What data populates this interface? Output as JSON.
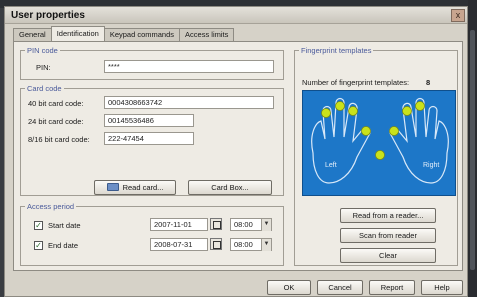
{
  "window": {
    "title": "User properties",
    "close_glyph": "x"
  },
  "tabs": [
    {
      "label": "General"
    },
    {
      "label": "Identification"
    },
    {
      "label": "Keypad commands"
    },
    {
      "label": "Access limits"
    }
  ],
  "pin": {
    "legend": "PIN code",
    "label": "PIN:",
    "value": "****"
  },
  "card": {
    "legend": "Card code",
    "rows": [
      {
        "label": "40 bit card code:",
        "value": "0004308663742"
      },
      {
        "label": "24 bit card code:",
        "value": "00145536486"
      },
      {
        "label": "8/16 bit card code:",
        "value": "222-47454"
      }
    ],
    "read_card": "Read card...",
    "card_box": "Card Box..."
  },
  "access": {
    "legend": "Access period",
    "start": {
      "label": "Start date",
      "date": "2007-11-01",
      "time": "08:00",
      "checked": true
    },
    "end": {
      "label": "End date",
      "date": "2008-07-31",
      "time": "08:00",
      "checked": true
    }
  },
  "fingerprint": {
    "legend": "Fingerprint templates",
    "count_label": "Number of fingerprint templates:",
    "count": "8",
    "left_hand": "Left",
    "right_hand": "Right",
    "accent": "#c9e21c",
    "read_reader": "Read from a reader...",
    "scan_reader": "Scan from reader",
    "clear": "Clear"
  },
  "footer": {
    "ok": "OK",
    "cancel": "Cancel",
    "report": "Report",
    "help": "Help"
  }
}
